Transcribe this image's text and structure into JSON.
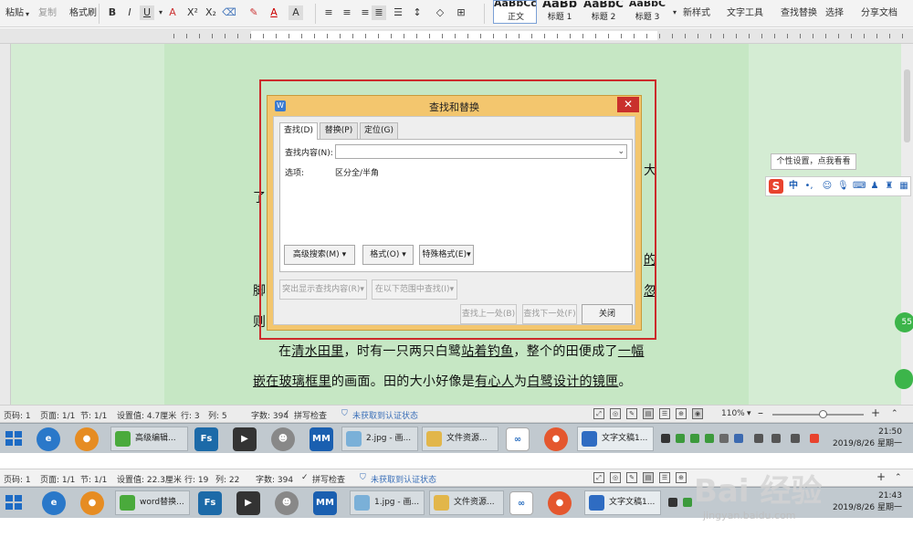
{
  "ribbon": {
    "paste": "粘贴",
    "copy": "复制",
    "format_painter": "格式刷",
    "styles": [
      {
        "preview": "AaBbCcDd",
        "label": "正文"
      },
      {
        "preview": "AaBb",
        "label": "标题 1"
      },
      {
        "preview": "AaBbC",
        "label": "标题 2"
      },
      {
        "preview": "AaBbC",
        "label": "标题 3"
      }
    ],
    "new_style": "新样式",
    "text_tools": "文字工具",
    "find_replace": "查找替换",
    "select": "选择",
    "share": "分享文档"
  },
  "document": {
    "lines": [
      {
        "text": "大",
        "style": "fragment"
      },
      {
        "text": "了",
        "style": "fragment"
      },
      {
        "text": "的",
        "style": "fragment-underline"
      },
      {
        "text": "脚",
        "style": "fragment"
      },
      {
        "text": "忽",
        "style": "fragment-underline"
      },
      {
        "text": "则",
        "style": "fragment"
      }
    ],
    "paragraph_line1": {
      "t1": "在",
      "u1": "清水田里",
      "t2": "，时有一只两只白鹭",
      "u2": "站着钓鱼",
      "t3": "，整个的田便成了",
      "u3": "一幅"
    },
    "paragraph_line2": {
      "u1": "嵌在玻璃框里",
      "t1": "的画面。田的大小好像是",
      "u2": "有心人",
      "t2": "为",
      "u3": "白鹭设计的镜匣",
      "t3": "。"
    }
  },
  "ime": {
    "tooltip": "个性设置，点我看看",
    "lang": "中",
    "punct": "•,",
    "bubble": "55"
  },
  "dialog": {
    "title": "查找和替换",
    "tabs": [
      "查找(D)",
      "替换(P)",
      "定位(G)"
    ],
    "find_label": "查找内容(N):",
    "find_value": "",
    "options_label": "选项:",
    "options_value": "区分全/半角",
    "buttons": {
      "advanced": "高级搜索(M)",
      "format": "格式(O)",
      "special": "特殊格式(E)",
      "highlight": "突出显示查找内容(R)",
      "find_in": "在以下范围中查找(I)",
      "prev": "查找上一处(B)",
      "next": "查找下一处(F)",
      "close": "关闭"
    }
  },
  "statusbar1": {
    "page": "页码: 1",
    "pages": "页面: 1/1",
    "section": "节: 1/1",
    "setting": "设置值: 4.7厘米",
    "row": "行: 3",
    "col": "列: 5",
    "words": "字数: 394",
    "spell": "拼写检查",
    "auth": "未获取到认证状态",
    "zoom": "110%",
    "zoom_level": 0.55
  },
  "taskbar1": {
    "windows": [
      "高级编辑...",
      "2.jpg - 画...",
      "文件资源...",
      "文字文稿1..."
    ],
    "time": "21:50",
    "date": "2019/8/26 星期一"
  },
  "statusbar2": {
    "page": "页码: 1",
    "pages": "页面: 1/1",
    "section": "节: 1/1",
    "setting": "设置值: 22.3厘米",
    "row": "行: 19",
    "col": "列: 22",
    "words": "字数: 394",
    "spell": "拼写检查",
    "auth": "未获取到认证状态"
  },
  "taskbar2": {
    "windows": [
      "word替换...",
      "1.jpg - 画...",
      "文件资源...",
      "文字文稿1..."
    ],
    "time": "21:43",
    "date": "2019/8/26 星期一"
  },
  "watermark": {
    "logo": "Bai 经验",
    "url": "jingyan.baidu.com"
  },
  "colors": {
    "doc_bg": "#c6e7c4",
    "dialog_frame": "#f3c66e",
    "highlight": "#cc2b2b",
    "close_button": "#c9302c"
  }
}
